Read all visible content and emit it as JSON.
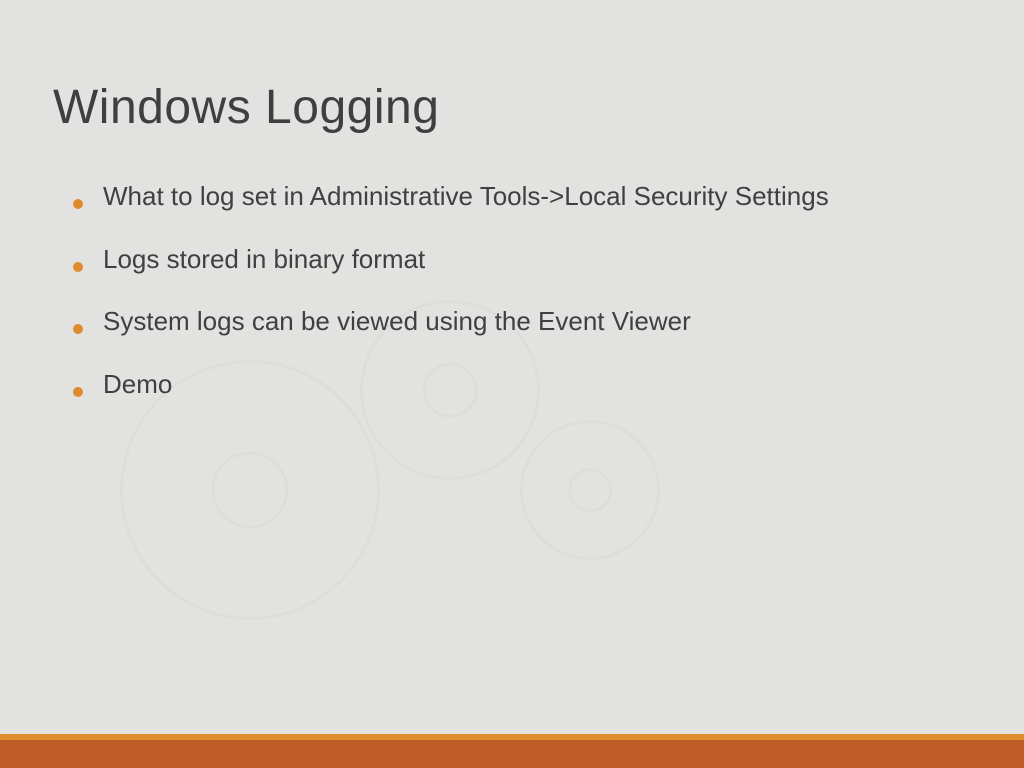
{
  "title": "Windows Logging",
  "bullets": [
    "What to log set in Administrative Tools->Local Security Settings",
    "Logs stored in binary format",
    "System logs can be viewed using the Event Viewer",
    "Demo"
  ],
  "colors": {
    "background": "#e2e2e0",
    "text": "#404040",
    "bullet": "#df8b2d",
    "footer_top": "#e08d30",
    "footer_bottom": "#c05d26"
  }
}
